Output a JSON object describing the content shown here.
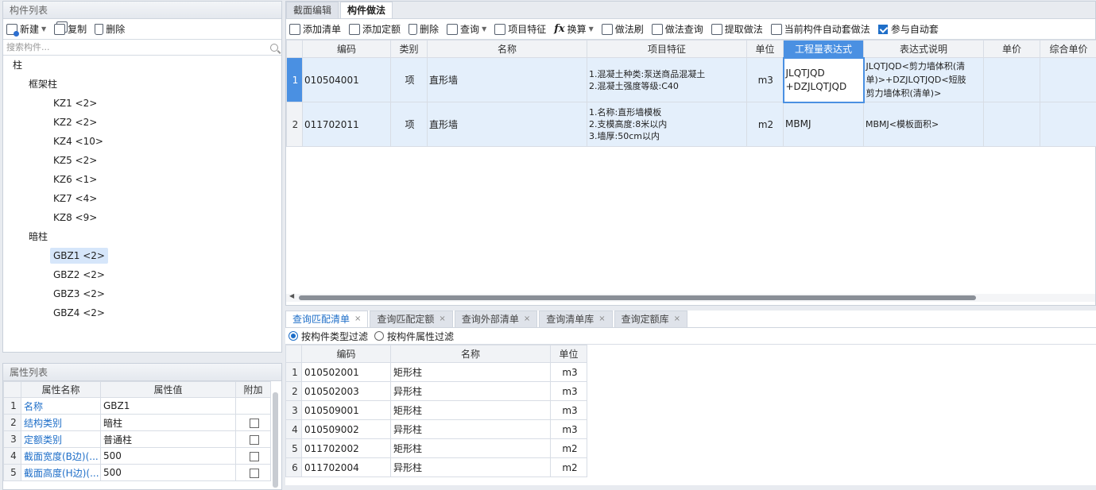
{
  "left_top": {
    "title": "构件列表",
    "toolbar": {
      "new": "新建",
      "copy": "复制",
      "delete": "删除"
    },
    "search_placeholder": "搜索构件...",
    "tree": {
      "root": "柱",
      "groups": [
        {
          "label": "框架柱",
          "items": [
            "KZ1 <2>",
            "KZ2 <2>",
            "KZ4 <10>",
            "KZ5 <2>",
            "KZ6 <1>",
            "KZ7 <4>",
            "KZ8 <9>"
          ]
        },
        {
          "label": "暗柱",
          "items": [
            "GBZ1 <2>",
            "GBZ2 <2>",
            "GBZ3 <2>",
            "GBZ4 <2>"
          ]
        }
      ],
      "selected": "GBZ1 <2>"
    }
  },
  "left_bottom": {
    "title": "属性列表",
    "columns": [
      "属性名称",
      "属性值",
      "附加"
    ],
    "rows": [
      {
        "n": "1",
        "name": "名称",
        "value": "GBZ1",
        "check": false
      },
      {
        "n": "2",
        "name": "结构类别",
        "value": "暗柱",
        "check": true
      },
      {
        "n": "3",
        "name": "定额类别",
        "value": "普通柱",
        "check": true
      },
      {
        "n": "4",
        "name": "截面宽度(B边)(...",
        "value": "500",
        "check": true
      },
      {
        "n": "5",
        "name": "截面高度(H边)(...",
        "value": "500",
        "check": true
      }
    ]
  },
  "right": {
    "tabs": [
      "截面编辑",
      "构件做法"
    ],
    "active_tab": 1,
    "toolbar": {
      "add_list": "添加清单",
      "add_quota": "添加定额",
      "delete": "删除",
      "query": "查询",
      "feature": "项目特征",
      "convert": "换算",
      "brush": "做法刷",
      "method_query": "做法查询",
      "extract": "提取做法",
      "auto_set": "当前构件自动套做法",
      "join_auto": "参与自动套"
    },
    "join_auto_checked": true,
    "columns": [
      "编码",
      "类别",
      "名称",
      "项目特征",
      "单位",
      "工程量表达式",
      "表达式说明",
      "单价",
      "综合单价"
    ],
    "rows": [
      {
        "n": "1",
        "code": "010504001",
        "type": "项",
        "name": "直形墙",
        "feature": [
          "1.混凝土种类:泵送商品混凝土",
          "2.混凝土强度等级:C40"
        ],
        "unit": "m3",
        "expr": [
          "JLQTJQD",
          "+DZJLQTJQD"
        ],
        "desc": [
          "JLQTJQD<剪力墙体积(清",
          "单)>+DZJLQTJQD<短肢",
          "剪力墙体积(清单)>"
        ]
      },
      {
        "n": "2",
        "code": "011702011",
        "type": "项",
        "name": "直形墙",
        "feature": [
          "1.名称:直形墙模板",
          "2.支模高度:8米以内",
          "3.墙厚:50cm以内"
        ],
        "unit": "m2",
        "expr": [
          "MBMJ"
        ],
        "desc": [
          "MBMJ<模板面积>"
        ]
      }
    ]
  },
  "bottom": {
    "tabs": [
      "查询匹配清单",
      "查询匹配定额",
      "查询外部清单",
      "查询清单库",
      "查询定额库"
    ],
    "filter": {
      "by_type": "按构件类型过滤",
      "by_attr": "按构件属性过滤",
      "selected": 0
    },
    "columns": [
      "编码",
      "名称",
      "单位"
    ],
    "rows": [
      {
        "n": "1",
        "code": "010502001",
        "name": "矩形柱",
        "unit": "m3"
      },
      {
        "n": "2",
        "code": "010502003",
        "name": "异形柱",
        "unit": "m3"
      },
      {
        "n": "3",
        "code": "010509001",
        "name": "矩形柱",
        "unit": "m3"
      },
      {
        "n": "4",
        "code": "010509002",
        "name": "异形柱",
        "unit": "m3"
      },
      {
        "n": "5",
        "code": "011702002",
        "name": "矩形柱",
        "unit": "m2"
      },
      {
        "n": "6",
        "code": "011702004",
        "name": "异形柱",
        "unit": "m2"
      }
    ]
  },
  "colors": {
    "accent": "#1e6ec8",
    "row_highlight": "#e4effb",
    "header_active": "#4a90e2"
  }
}
